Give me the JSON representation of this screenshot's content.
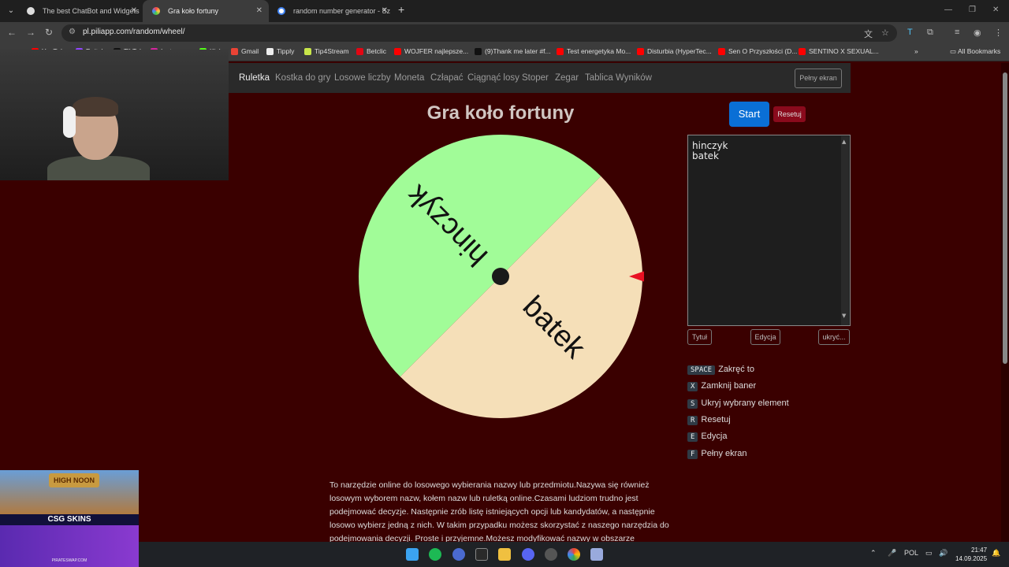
{
  "browser": {
    "tabs": [
      {
        "title": "The best ChatBot and Widgets",
        "active": false
      },
      {
        "title": "Gra koło fortuny",
        "active": true
      },
      {
        "title": "random number generator - Sz",
        "active": false
      }
    ],
    "url": "pl.piliapp.com/random/wheel/",
    "bookmarks": [
      "YouTube",
      "Twitch",
      "TikTok",
      "Instagram",
      "Kick",
      "Gmail",
      "Tipply",
      "Tip4Stream",
      "Betclic",
      "WOJFER najlepsze...",
      "(9)Thank me later #f...",
      "Test energetyka Mo...",
      "Disturbia (HyperTec...",
      "Sen O Przyszłości (D...",
      "SENTINO X SEXUAL..."
    ],
    "all_bookmarks": "All Bookmarks"
  },
  "nav": {
    "items": [
      "Ruletka",
      "Kostka do gry",
      "Losowe liczby",
      "Moneta",
      "Człapać",
      "Ciągnąć losy",
      "Stoper",
      "Zegar",
      "Tablica Wyników"
    ],
    "fullscreen": "Pełny ekran"
  },
  "page": {
    "title": "Gra koło fortuny",
    "start": "Start",
    "reset": "Resetuj",
    "entries": [
      "hinczyk",
      "batek"
    ],
    "buttons": {
      "title": "Tytuł",
      "edit": "Edycja",
      "hide": "ukryć..."
    }
  },
  "wheel": {
    "segments": [
      {
        "label": "hinczyk",
        "color": "#a1fc98"
      },
      {
        "label": "batek",
        "color": "#f5dfb8"
      }
    ],
    "pointer_color": "#e81123",
    "hub_color": "#1a1a1a"
  },
  "shortcuts": [
    {
      "key": "SPACE",
      "label": "Zakręć to"
    },
    {
      "key": "X",
      "label": "Zamknij baner"
    },
    {
      "key": "S",
      "label": "Ukryj wybrany element"
    },
    {
      "key": "R",
      "label": "Resetuj"
    },
    {
      "key": "E",
      "label": "Edycja"
    },
    {
      "key": "F",
      "label": "Pełny ekran"
    }
  ],
  "description": "To narzędzie online do losowego wybierania nazwy lub przedmiotu.Nazywa się również losowym wyborem nazw, kołem nazw lub ruletką online.Czasami ludziom trudno jest podejmować decyzje. Następnie zrób listę istniejących opcji lub kandydatów, a następnie losowo wybierz jedną z nich. W takim przypadku możesz skorzystać z naszego narzędzia do podejmowania decyzji. Proste i przyjemne.Możesz modyfikować nazwy w obszarze",
  "ad": {
    "sign": "HIGH NOON",
    "brand": "CSG SKINS",
    "foot": "PIRATESWAP.COM"
  },
  "taskbar": {
    "lang": "POL",
    "time": "21:47",
    "date": "14.09.2025"
  }
}
